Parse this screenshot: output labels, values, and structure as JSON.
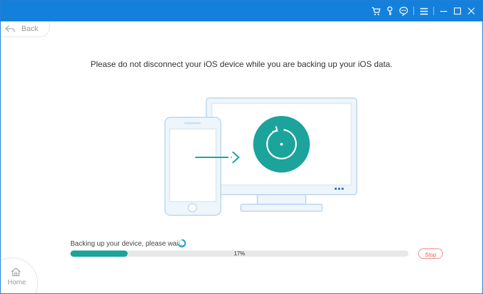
{
  "titlebar": {
    "icons": [
      "cart-icon",
      "key-icon",
      "chat-icon",
      "menu-icon",
      "minimize-icon",
      "maximize-icon",
      "close-icon"
    ],
    "color": "#1580db"
  },
  "nav": {
    "back_label": "Back",
    "home_label": "Home"
  },
  "main": {
    "notice": "Please do not disconnect your iOS device while you are backing up your iOS data."
  },
  "progress": {
    "status_text": "Backing up your device, please wait..",
    "percent": 17,
    "percent_label": "17%",
    "stop_label": "Stop",
    "accent": "#1ba39c"
  }
}
